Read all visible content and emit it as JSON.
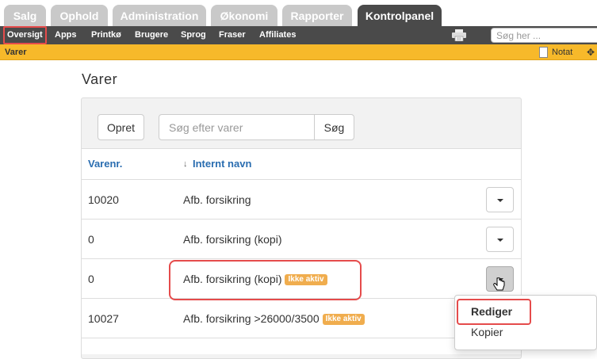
{
  "main_tabs": [
    {
      "label": "Salg",
      "active": false
    },
    {
      "label": "Ophold",
      "active": false
    },
    {
      "label": "Administration",
      "active": false
    },
    {
      "label": "Økonomi",
      "active": false
    },
    {
      "label": "Rapporter",
      "active": false
    },
    {
      "label": "Kontrolpanel",
      "active": true
    }
  ],
  "subnav": [
    "Oversigt",
    "Apps",
    "Printkø",
    "Brugere",
    "Sprog",
    "Fraser",
    "Affiliates"
  ],
  "top_search": {
    "placeholder": "Søg her ..."
  },
  "section_bar": {
    "title": "Varer",
    "note_label": "Notat",
    "move_glyph": "✥"
  },
  "page": {
    "title": "Varer"
  },
  "toolbar": {
    "create_label": "Opret",
    "search_placeholder": "Søg efter varer",
    "search_button": "Søg"
  },
  "table": {
    "columns": [
      "Varenr.",
      "Internt navn"
    ],
    "sort_arrow": "↓",
    "rows": [
      {
        "number": "10020",
        "name": "Afb. forsikring",
        "badge": ""
      },
      {
        "number": "0",
        "name": "Afb. forsikring (kopi)",
        "badge": ""
      },
      {
        "number": "0",
        "name": "Afb. forsikring (kopi)",
        "badge": "Ikke aktiv"
      },
      {
        "number": "10027",
        "name": "Afb. forsikring >26000/3500",
        "badge": "Ikke aktiv"
      }
    ]
  },
  "dropdown_menu": {
    "items": [
      "Rediger",
      "Kopier"
    ]
  },
  "colors": {
    "accent_yellow": "#f7b92a",
    "nav_dark": "#4a4a4a",
    "link_blue": "#2a6db0",
    "badge_orange": "#f0ad4e",
    "highlight_red": "#e54b4b"
  }
}
